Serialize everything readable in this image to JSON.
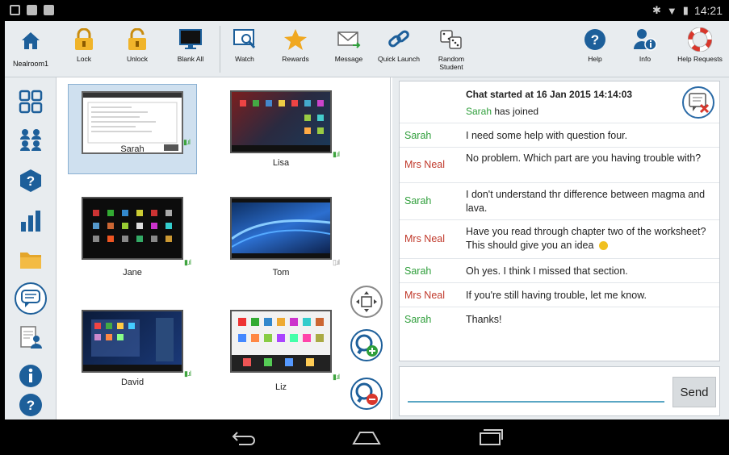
{
  "statusbar": {
    "time": "14:21"
  },
  "room": {
    "name": "Nealroom1"
  },
  "toolbar": {
    "lock": "Lock",
    "unlock": "Unlock",
    "blank_all": "Blank All",
    "watch": "Watch",
    "rewards": "Rewards",
    "message": "Message",
    "quick_launch": "Quick Launch",
    "random_student": "Random Student",
    "help": "Help",
    "info": "Info",
    "help_requests": "Help Requests"
  },
  "thumbnails": [
    {
      "name": "Sarah",
      "selected": true
    },
    {
      "name": "Lisa",
      "selected": false
    },
    {
      "name": "Jane",
      "selected": false
    },
    {
      "name": "Tom",
      "selected": false
    },
    {
      "name": "David",
      "selected": false
    },
    {
      "name": "Liz",
      "selected": false
    }
  ],
  "chat": {
    "started": "Chat started at 16 Jan 2015 14:14:03",
    "joined_name": "Sarah",
    "joined_text": "has joined",
    "messages": [
      {
        "sender": "Sarah",
        "text": "I need some help with question four."
      },
      {
        "sender": "Mrs Neal",
        "text": "No problem. Which part are you having trouble with?"
      },
      {
        "sender": "Sarah",
        "text": "I don't understand thr difference between magma and lava."
      },
      {
        "sender": "Mrs Neal",
        "text": "Have you read through chapter two of the worksheet? This should give you an idea"
      },
      {
        "sender": "Sarah",
        "text": "Oh yes. I think I missed that section."
      },
      {
        "sender": "Mrs Neal",
        "text": "If you're still having trouble, let me know."
      },
      {
        "sender": "Sarah",
        "text": "Thanks!"
      }
    ],
    "input_value": "",
    "send_label": "Send"
  },
  "colors": {
    "accent_blue": "#1d5f9a",
    "student_green": "#2e9e3a",
    "teacher_red": "#c0392b",
    "lock_yellow": "#f0b42a"
  }
}
